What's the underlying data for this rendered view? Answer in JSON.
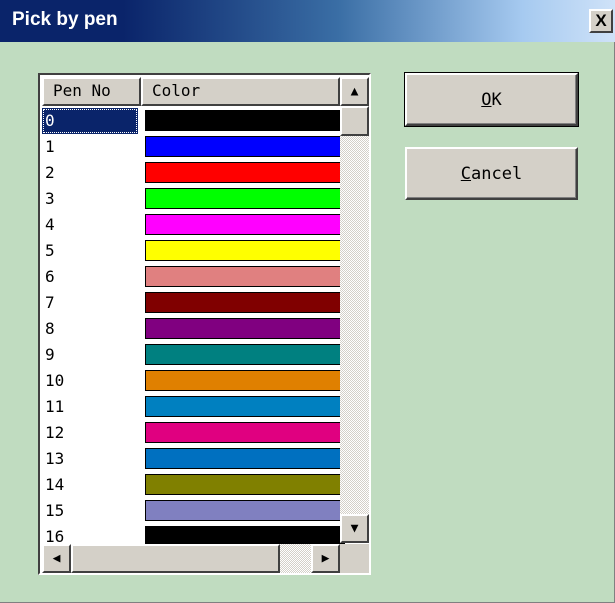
{
  "window": {
    "title": "Pick by pen",
    "close_label": "X"
  },
  "list": {
    "columns": [
      "Pen No",
      "Color"
    ],
    "selected_index": 0,
    "rows": [
      {
        "pen": "0",
        "color": "#000000"
      },
      {
        "pen": "1",
        "color": "#0000ff"
      },
      {
        "pen": "2",
        "color": "#ff0000"
      },
      {
        "pen": "3",
        "color": "#00ff00"
      },
      {
        "pen": "4",
        "color": "#ff00ff"
      },
      {
        "pen": "5",
        "color": "#ffff00"
      },
      {
        "pen": "6",
        "color": "#e08080"
      },
      {
        "pen": "7",
        "color": "#800000"
      },
      {
        "pen": "8",
        "color": "#800080"
      },
      {
        "pen": "9",
        "color": "#008080"
      },
      {
        "pen": "10",
        "color": "#e08000"
      },
      {
        "pen": "11",
        "color": "#0080c0"
      },
      {
        "pen": "12",
        "color": "#e00080"
      },
      {
        "pen": "13",
        "color": "#0070c0"
      },
      {
        "pen": "14",
        "color": "#808000"
      },
      {
        "pen": "15",
        "color": "#8080c0"
      },
      {
        "pen": "16",
        "color": "#000000"
      }
    ],
    "scroll_arrows": {
      "up": "up-arrow-icon",
      "down": "down-arrow-icon",
      "left": "left-arrow-icon",
      "right": "right-arrow-icon"
    }
  },
  "buttons": {
    "ok": {
      "accel": "O",
      "rest": "K"
    },
    "cancel": {
      "accel": "C",
      "rest": "ancel"
    }
  }
}
